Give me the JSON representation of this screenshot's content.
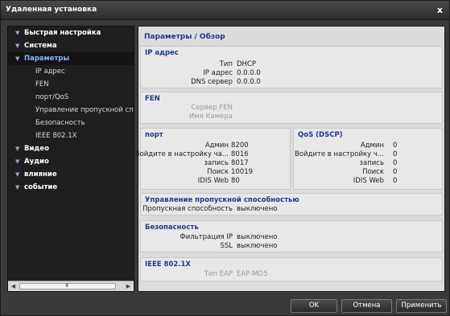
{
  "window": {
    "title": "Удаленная установка",
    "close": "x"
  },
  "sidebar": {
    "nodes": [
      {
        "label": "Быстрая настройка"
      },
      {
        "label": "Система"
      },
      {
        "label": "Параметры"
      },
      {
        "label": "Видео"
      },
      {
        "label": "Аудио"
      },
      {
        "label": "влияние"
      },
      {
        "label": "событие"
      }
    ],
    "children": [
      "IP адрес",
      "FEN",
      "порт/QoS",
      "Управление пропускной спос",
      "Безопасность",
      "IEEE 802.1X"
    ],
    "scroll_grip": "III"
  },
  "panel": {
    "title": "Параметры / Обзор",
    "ip": {
      "heading": "IP адрес",
      "rows": [
        {
          "k": "Тип",
          "v": "DHCP"
        },
        {
          "k": "IP адрес",
          "v": "0.0.0.0"
        },
        {
          "k": "DNS сервер",
          "v": "0.0.0.0"
        }
      ]
    },
    "fen": {
      "heading": "FEN",
      "rows": [
        {
          "k": "Сервер FEN",
          "v": ""
        },
        {
          "k": "Имя Камера",
          "v": ""
        }
      ]
    },
    "port": {
      "heading": "порт",
      "rows": [
        {
          "k": "Админ",
          "v": "8200"
        },
        {
          "k": "Войдите в настройку ча...",
          "v": "8016"
        },
        {
          "k": "запись",
          "v": "8017"
        },
        {
          "k": "Поиск",
          "v": "10019"
        },
        {
          "k": "IDIS Web",
          "v": "80"
        }
      ]
    },
    "qos": {
      "heading": "QoS (DSCP)",
      "rows": [
        {
          "k": "Админ",
          "v": "0"
        },
        {
          "k": "Войдите в настройку ч...",
          "v": "0"
        },
        {
          "k": "запись",
          "v": "0"
        },
        {
          "k": "Поиск",
          "v": "0"
        },
        {
          "k": "IDIS Web",
          "v": "0"
        }
      ]
    },
    "bw": {
      "heading": "Управление пропускной способностью",
      "rows": [
        {
          "k": "Пропускная способность",
          "v": "выключено"
        }
      ]
    },
    "sec": {
      "heading": "Безопасность",
      "rows": [
        {
          "k": "Фильтрация IP",
          "v": "выключено"
        },
        {
          "k": "SSL",
          "v": "выключено"
        }
      ]
    },
    "ieee": {
      "heading": "IEEE 802.1X",
      "rows": [
        {
          "k": "Тип EAP",
          "v": "EAP-MD5"
        }
      ]
    }
  },
  "buttons": {
    "ok": "OK",
    "cancel": "Отмена",
    "apply": "Применить"
  }
}
